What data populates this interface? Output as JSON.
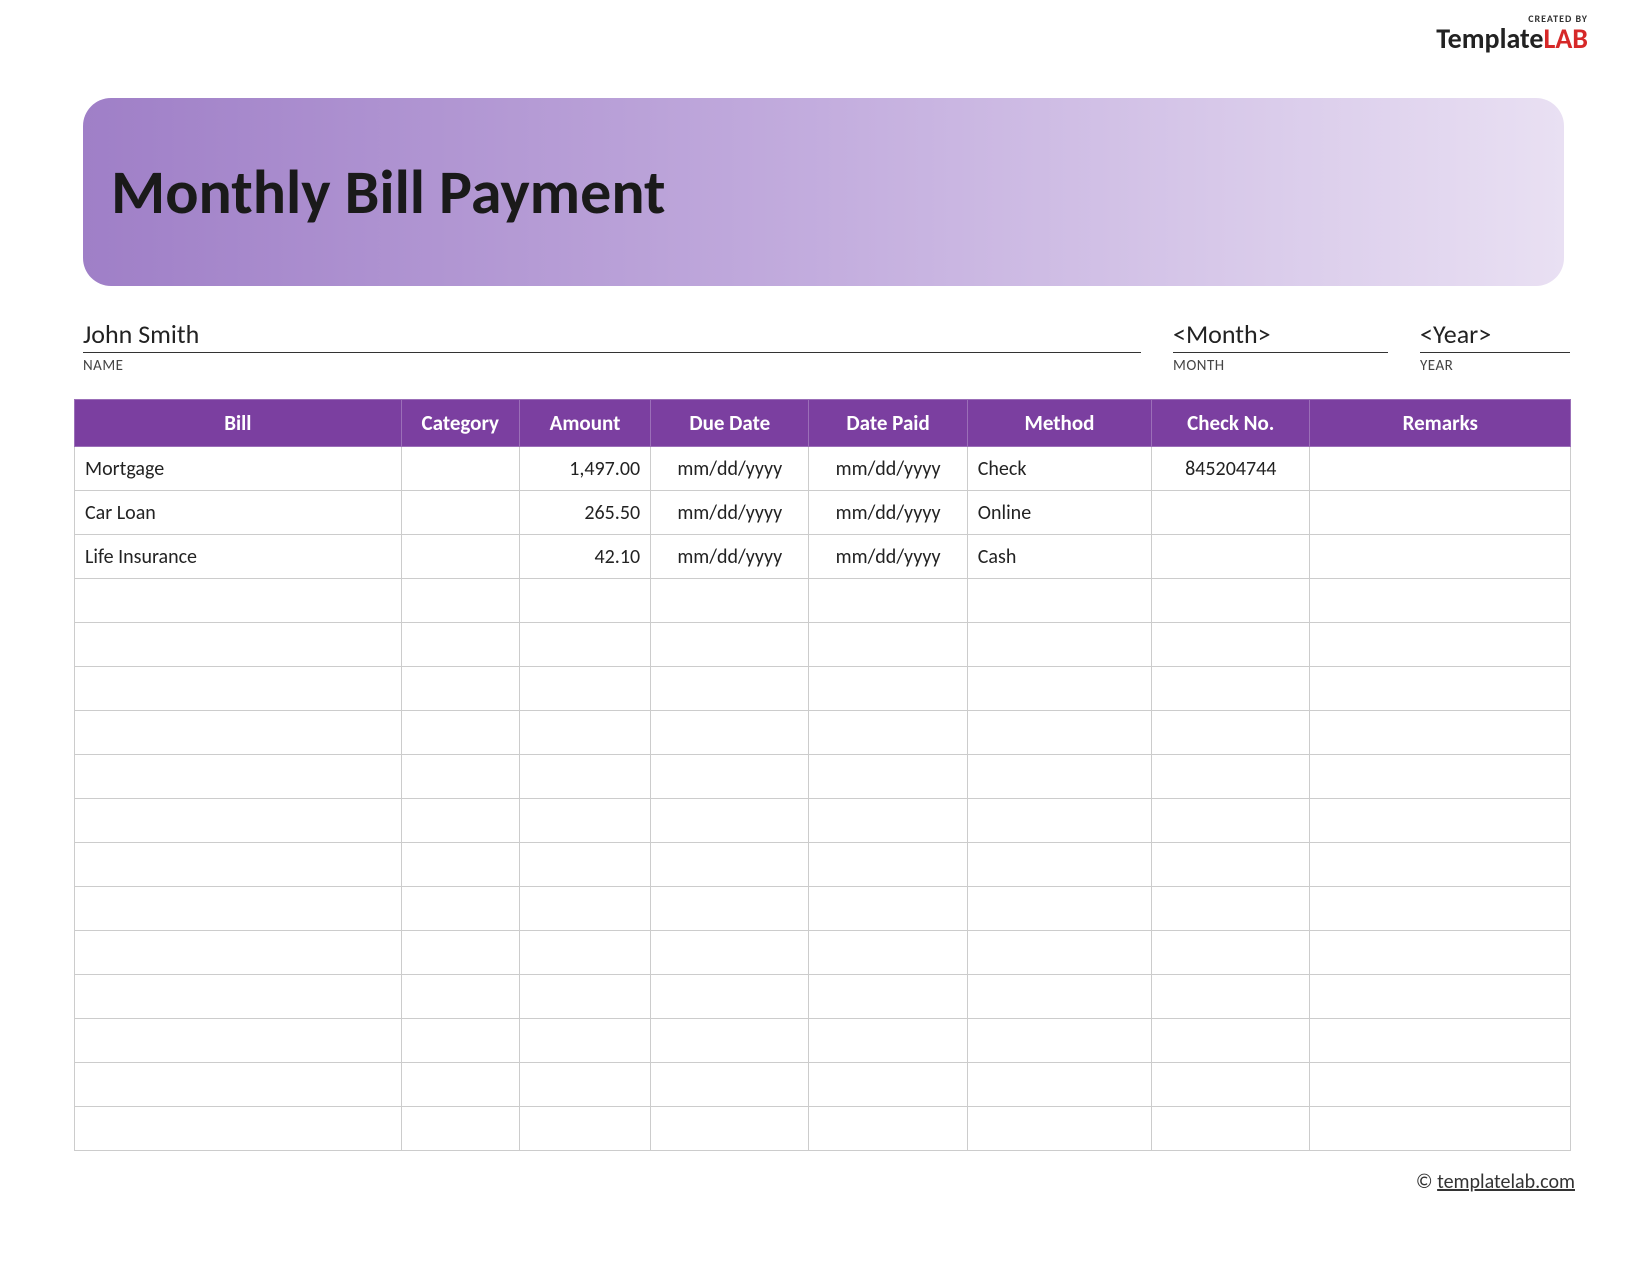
{
  "logo": {
    "created_by": "CREATED BY",
    "brand_template": "Template",
    "brand_lab": "LAB"
  },
  "header": {
    "title": "Monthly Bill Payment"
  },
  "info": {
    "name_value": "John Smith",
    "name_label": "NAME",
    "month_value": "<Month>",
    "month_label": "MONTH",
    "year_value": "<Year>",
    "year_label": "YEAR"
  },
  "table": {
    "headers": {
      "bill": "Bill",
      "category": "Category",
      "amount": "Amount",
      "due_date": "Due Date",
      "date_paid": "Date Paid",
      "method": "Method",
      "check_no": "Check No.",
      "remarks": "Remarks"
    },
    "rows": [
      {
        "bill": "Mortgage",
        "category": "",
        "amount": "1,497.00",
        "due_date": "mm/dd/yyyy",
        "date_paid": "mm/dd/yyyy",
        "method": "Check",
        "check_no": "845204744",
        "remarks": ""
      },
      {
        "bill": "Car Loan",
        "category": "",
        "amount": "265.50",
        "due_date": "mm/dd/yyyy",
        "date_paid": "mm/dd/yyyy",
        "method": "Online",
        "check_no": "",
        "remarks": ""
      },
      {
        "bill": "Life Insurance",
        "category": "",
        "amount": "42.10",
        "due_date": "mm/dd/yyyy",
        "date_paid": "mm/dd/yyyy",
        "method": "Cash",
        "check_no": "",
        "remarks": ""
      },
      {
        "bill": "",
        "category": "",
        "amount": "",
        "due_date": "",
        "date_paid": "",
        "method": "",
        "check_no": "",
        "remarks": ""
      },
      {
        "bill": "",
        "category": "",
        "amount": "",
        "due_date": "",
        "date_paid": "",
        "method": "",
        "check_no": "",
        "remarks": ""
      },
      {
        "bill": "",
        "category": "",
        "amount": "",
        "due_date": "",
        "date_paid": "",
        "method": "",
        "check_no": "",
        "remarks": ""
      },
      {
        "bill": "",
        "category": "",
        "amount": "",
        "due_date": "",
        "date_paid": "",
        "method": "",
        "check_no": "",
        "remarks": ""
      },
      {
        "bill": "",
        "category": "",
        "amount": "",
        "due_date": "",
        "date_paid": "",
        "method": "",
        "check_no": "",
        "remarks": ""
      },
      {
        "bill": "",
        "category": "",
        "amount": "",
        "due_date": "",
        "date_paid": "",
        "method": "",
        "check_no": "",
        "remarks": ""
      },
      {
        "bill": "",
        "category": "",
        "amount": "",
        "due_date": "",
        "date_paid": "",
        "method": "",
        "check_no": "",
        "remarks": ""
      },
      {
        "bill": "",
        "category": "",
        "amount": "",
        "due_date": "",
        "date_paid": "",
        "method": "",
        "check_no": "",
        "remarks": ""
      },
      {
        "bill": "",
        "category": "",
        "amount": "",
        "due_date": "",
        "date_paid": "",
        "method": "",
        "check_no": "",
        "remarks": ""
      },
      {
        "bill": "",
        "category": "",
        "amount": "",
        "due_date": "",
        "date_paid": "",
        "method": "",
        "check_no": "",
        "remarks": ""
      },
      {
        "bill": "",
        "category": "",
        "amount": "",
        "due_date": "",
        "date_paid": "",
        "method": "",
        "check_no": "",
        "remarks": ""
      },
      {
        "bill": "",
        "category": "",
        "amount": "",
        "due_date": "",
        "date_paid": "",
        "method": "",
        "check_no": "",
        "remarks": ""
      },
      {
        "bill": "",
        "category": "",
        "amount": "",
        "due_date": "",
        "date_paid": "",
        "method": "",
        "check_no": "",
        "remarks": ""
      }
    ]
  },
  "footer": {
    "copyright": "©",
    "link_text": "templatelab.com"
  }
}
